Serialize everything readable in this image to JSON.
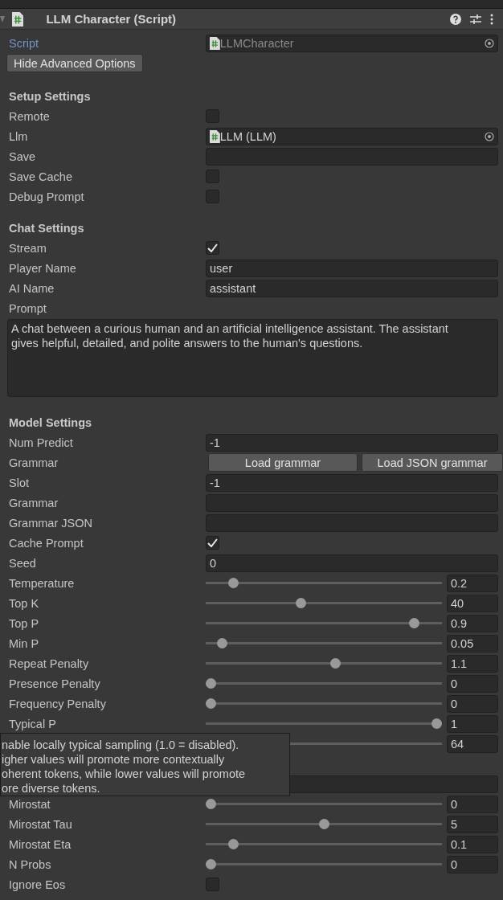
{
  "header": {
    "title": "LLM Character (Script)"
  },
  "script_field": {
    "label": "Script",
    "value": "LLMCharacter"
  },
  "advanced_button": "Hide Advanced Options",
  "sections": [
    {
      "title": "Setup Settings",
      "rows": [
        {
          "kind": "checkbox",
          "label": "Remote",
          "checked": false
        },
        {
          "kind": "object",
          "label": "Llm",
          "value": "LLM (LLM)"
        },
        {
          "kind": "text",
          "label": "Save"
        },
        {
          "kind": "checkbox",
          "label": "Save Cache",
          "checked": false
        },
        {
          "kind": "checkbox",
          "label": "Debug Prompt",
          "checked": false
        }
      ]
    },
    {
      "title": "Chat Settings",
      "rows": [
        {
          "kind": "checkbox",
          "label": "Stream",
          "checked": true
        },
        {
          "kind": "text",
          "label": "Player Name",
          "value": "user"
        },
        {
          "kind": "text",
          "label": "AI Name",
          "value": "assistant"
        },
        {
          "kind": "textarea",
          "label": "Prompt",
          "value": "A chat between a curious human and an artificial intelligence assistant. The assistant gives helpful, detailed, and polite answers to the human's questions."
        }
      ]
    },
    {
      "title": "Model Settings",
      "rows": [
        {
          "kind": "text",
          "label": "Num Predict",
          "value": "-1"
        },
        {
          "kind": "buttons",
          "label": "Grammar",
          "buttons": [
            "Load grammar",
            "Load JSON grammar"
          ]
        },
        {
          "kind": "text",
          "label": "Slot",
          "value": "-1"
        },
        {
          "kind": "text",
          "label": "Grammar"
        },
        {
          "kind": "text",
          "label": "Grammar JSON"
        },
        {
          "kind": "checkbox",
          "label": "Cache Prompt",
          "checked": true
        },
        {
          "kind": "text",
          "label": "Seed",
          "value": "0"
        },
        {
          "kind": "slider",
          "label": "Temperature",
          "level": 0.1,
          "value": "0.2"
        },
        {
          "kind": "slider",
          "label": "Top K",
          "level": 0.4,
          "value": "40"
        },
        {
          "kind": "slider",
          "label": "Top P",
          "level": 0.9,
          "value": "0.9"
        },
        {
          "kind": "slider",
          "label": "Min P",
          "level": 0.05,
          "value": "0.05"
        },
        {
          "kind": "slider",
          "label": "Repeat Penalty",
          "level": 0.55,
          "value": "1.1"
        },
        {
          "kind": "slider",
          "label": "Presence Penalty",
          "level": 0,
          "value": "0"
        },
        {
          "kind": "slider",
          "label": "Frequency Penalty",
          "level": 0,
          "value": "0"
        },
        {
          "kind": "slider",
          "label": "Typical P",
          "level": 1,
          "value": "1"
        },
        {
          "kind": "track",
          "value": "64"
        },
        {
          "kind": "spacer"
        },
        {
          "kind": "text"
        },
        {
          "kind": "slider",
          "label": "Mirostat",
          "level": 0,
          "value": "0"
        },
        {
          "kind": "slider",
          "label": "Mirostat Tau",
          "level": 0.5,
          "value": "5"
        },
        {
          "kind": "slider",
          "label": "Mirostat Eta",
          "level": 0.1,
          "value": "0.1"
        },
        {
          "kind": "slider",
          "label": "N Probs",
          "level": 0,
          "value": "0"
        },
        {
          "kind": "checkbox",
          "label": "Ignore Eos",
          "checked": false
        }
      ]
    }
  ],
  "tooltip": {
    "lines": [
      "nable locally typical sampling (1.0 = disabled).",
      "igher values will promote more contextually",
      "oherent tokens, while  lower values will promote",
      "ore diverse tokens."
    ]
  }
}
